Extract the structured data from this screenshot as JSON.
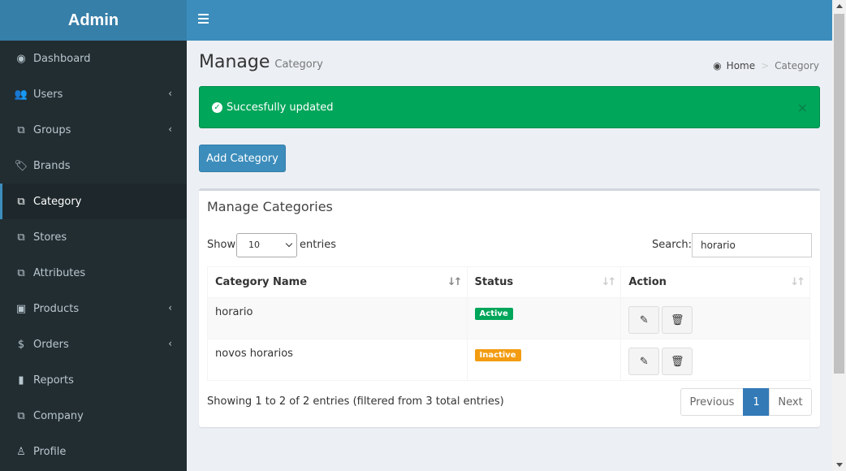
{
  "app": {
    "logo": "Admin"
  },
  "sidebar": {
    "items": [
      {
        "label": "Dashboard",
        "icon": "dashboard-icon",
        "glyph": "◉",
        "caret": false
      },
      {
        "label": "Users",
        "icon": "users-icon",
        "glyph": "👥",
        "caret": true
      },
      {
        "label": "Groups",
        "icon": "groups-icon",
        "glyph": "⧉",
        "caret": true
      },
      {
        "label": "Brands",
        "icon": "tags-icon",
        "glyph": "🏷",
        "caret": false
      },
      {
        "label": "Category",
        "icon": "category-icon",
        "glyph": "⧉",
        "caret": false,
        "active": true
      },
      {
        "label": "Stores",
        "icon": "stores-icon",
        "glyph": "⧉",
        "caret": false
      },
      {
        "label": "Attributes",
        "icon": "attributes-icon",
        "glyph": "⧉",
        "caret": false
      },
      {
        "label": "Products",
        "icon": "cube-icon",
        "glyph": "▣",
        "caret": true
      },
      {
        "label": "Orders",
        "icon": "dollar-icon",
        "glyph": "$",
        "caret": true
      },
      {
        "label": "Reports",
        "icon": "bar-chart-icon",
        "glyph": "▮",
        "caret": false
      },
      {
        "label": "Company",
        "icon": "company-icon",
        "glyph": "⧉",
        "caret": false
      },
      {
        "label": "Profile",
        "icon": "user-icon",
        "glyph": "♙",
        "caret": false
      }
    ]
  },
  "page": {
    "title": "Manage",
    "subtitle": "Category"
  },
  "breadcrumb": {
    "home": "Home",
    "current": "Category"
  },
  "alert": {
    "message": "Succesfully updated",
    "close": "×"
  },
  "toolbar": {
    "add_label": "Add Category"
  },
  "box": {
    "title": "Manage Categories"
  },
  "datatable": {
    "show_label": "Show",
    "length_value": "10",
    "entries_label": "entries",
    "search_label": "Search:",
    "search_value": "horario",
    "columns": [
      "Category Name",
      "Status",
      "Action"
    ],
    "rows": [
      {
        "name": "horario",
        "status": "Active",
        "status_type": "success"
      },
      {
        "name": "novos horarios",
        "status": "Inactive",
        "status_type": "warning"
      }
    ],
    "info": "Showing 1 to 2 of 2 entries (filtered from 3 total entries)",
    "pagination": {
      "previous": "Previous",
      "current": "1",
      "next": "Next"
    }
  },
  "colors": {
    "header": "#3c8dbc",
    "logo": "#367fa9",
    "sidebar": "#222d32",
    "success": "#00a65a",
    "warning": "#f39c12"
  }
}
